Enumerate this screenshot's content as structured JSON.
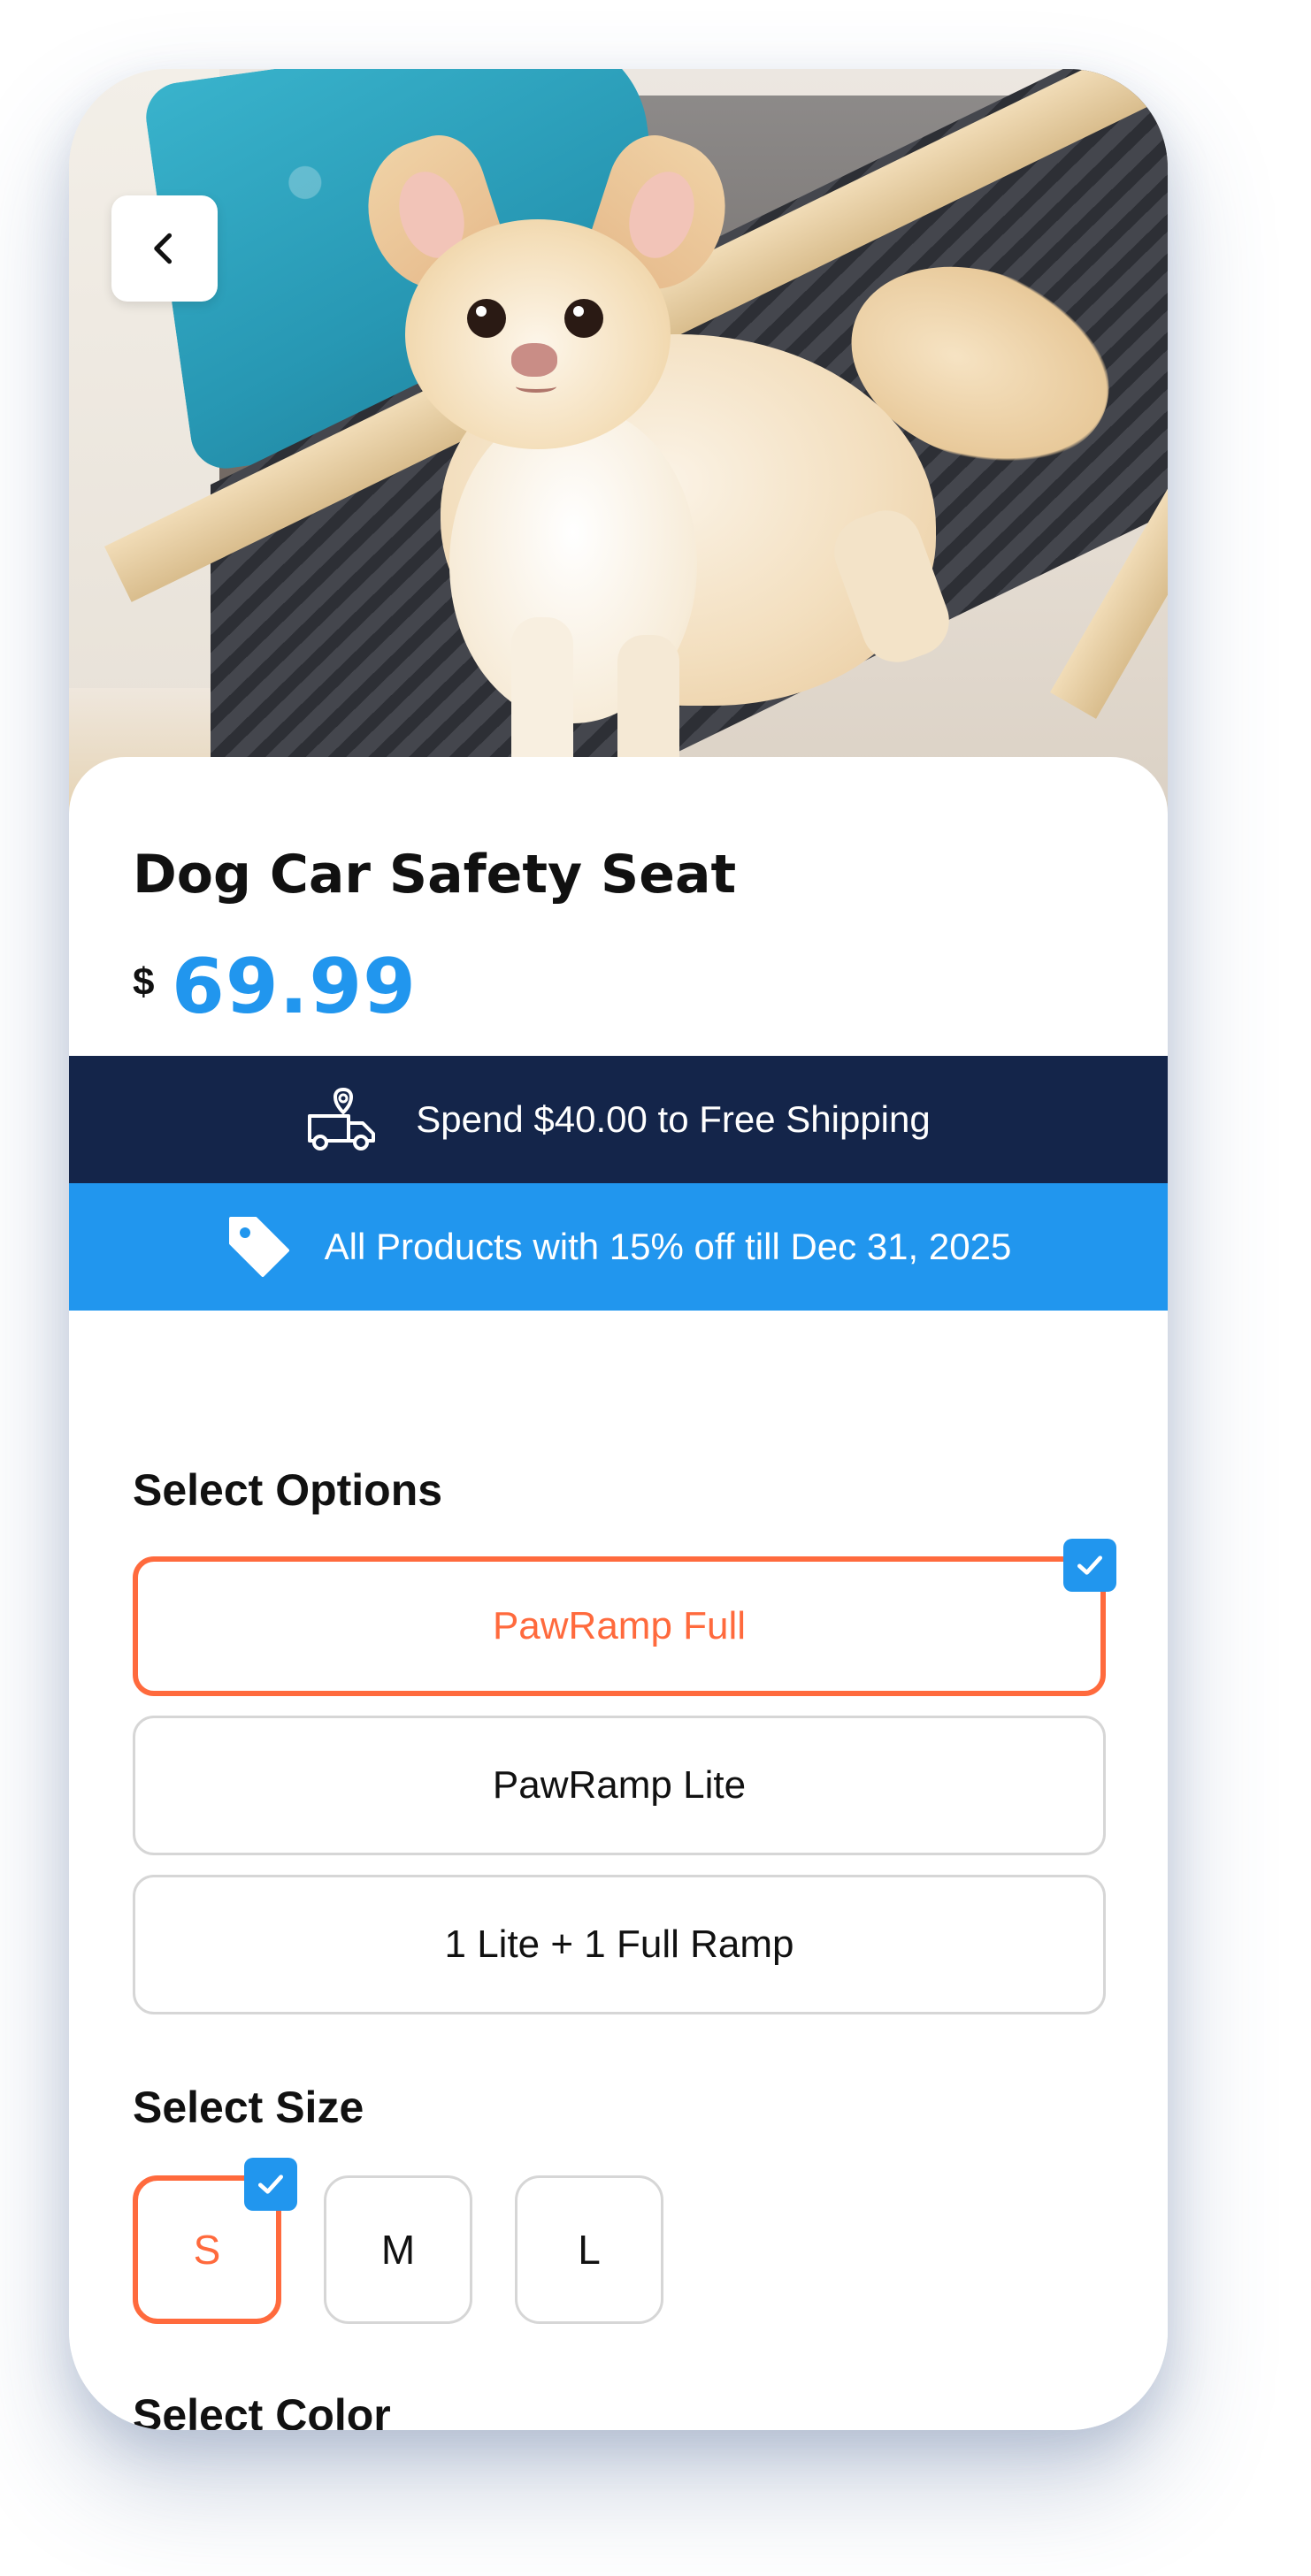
{
  "product": {
    "title": "Dog Car Safety Seat",
    "currency": "$",
    "price": "69.99"
  },
  "banners": {
    "shipping": "Spend $40.00 to Free Shipping",
    "promo": "All Products with 15% off till Dec 31, 2025"
  },
  "options": {
    "label": "Select Options",
    "items": [
      "PawRamp Full",
      "PawRamp Lite",
      "1 Lite + 1 Full Ramp"
    ],
    "selected": "PawRamp Full"
  },
  "sizes": {
    "label": "Select Size",
    "items": [
      "S",
      "M",
      "L"
    ],
    "selected": "S"
  },
  "colors": {
    "label": "Select Color",
    "swatches": [
      "#ff6a3d",
      "#ffc04d",
      "#2196ee",
      "#14254a",
      "#000000"
    ],
    "selected_index": 3
  },
  "theme": {
    "accent": "#2196ee",
    "selected": "#ff6a3d",
    "navy": "#14254a"
  },
  "icons": {
    "back": "chevron-left-icon",
    "shipping": "delivery-truck-location-icon",
    "promo": "price-tag-icon",
    "check": "checkmark-icon"
  }
}
